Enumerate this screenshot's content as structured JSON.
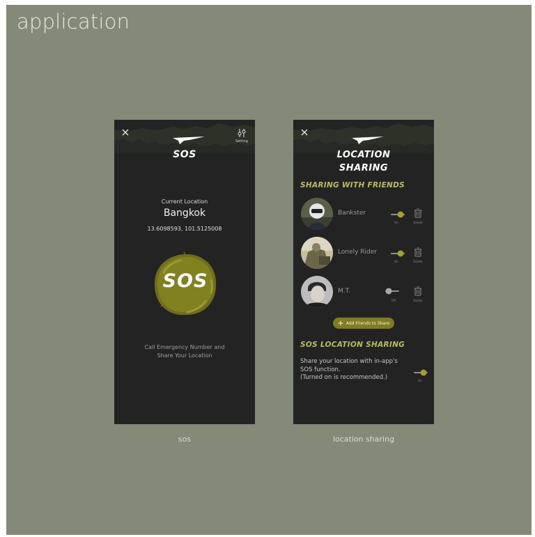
{
  "page": {
    "title": "application"
  },
  "screens": {
    "sos": {
      "caption": "sos",
      "title": "SOS",
      "setting_label": "Setting",
      "location_label": "Current Location",
      "city": "Bangkok",
      "coords": "13.6098593, 101.5125008",
      "sos_button": "SOS",
      "desc_line1": "Call Emergency Number and",
      "desc_line2": "Share Your Location"
    },
    "location": {
      "caption": "location sharing",
      "title_line1": "LOCATION",
      "title_line2": "SHARING",
      "friends_head": "SHARING WITH FRIENDS",
      "friends": [
        {
          "name": "Bankster",
          "on": true,
          "toggle_label": "On",
          "delete_label": "Delete"
        },
        {
          "name": "Lonely Rider",
          "on": true,
          "toggle_label": "On",
          "delete_label": "Delete"
        },
        {
          "name": "M.T.",
          "on": false,
          "toggle_label": "Off",
          "delete_label": "Delete"
        }
      ],
      "add_button": "Add Friends to Share",
      "sos_head": "SOS LOCATION SHARING",
      "sos_desc1": "Share your location with in-app's",
      "sos_desc2": "SOS function.",
      "sos_desc3": "(Turned on is recommended.)",
      "sos_toggle_label": "On"
    }
  },
  "colors": {
    "accent": "#9c9a2a",
    "phone_bg": "#232323",
    "board_bg": "#858a78"
  },
  "icons": [
    "close-icon",
    "setting-icon",
    "trash-icon",
    "plus-icon",
    "logo-icon"
  ]
}
